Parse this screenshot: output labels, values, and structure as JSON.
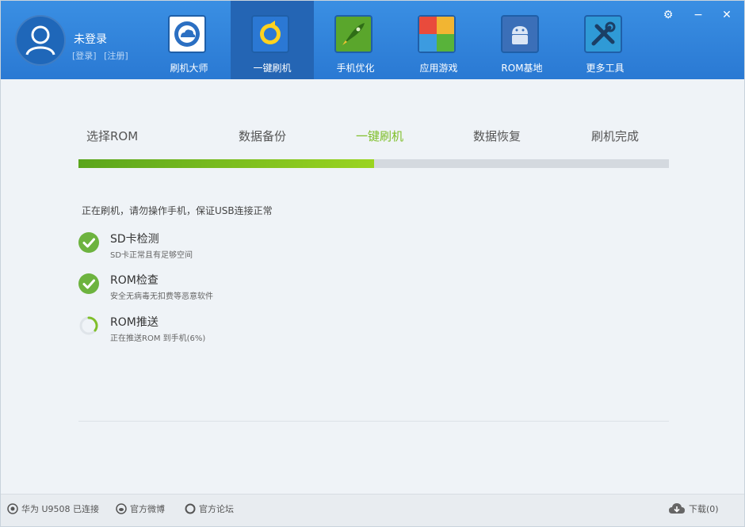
{
  "user": {
    "name": "未登录",
    "login": "[登录]",
    "register": "[注册]"
  },
  "nav": [
    {
      "label": "刷机大师",
      "icon": "cloud-icon",
      "active": false
    },
    {
      "label": "一键刷机",
      "icon": "refresh-icon",
      "active": true
    },
    {
      "label": "手机优化",
      "icon": "rocket-icon",
      "active": false
    },
    {
      "label": "应用游戏",
      "icon": "tiles-icon",
      "active": false
    },
    {
      "label": "ROM基地",
      "icon": "android-icon",
      "active": false
    },
    {
      "label": "更多工具",
      "icon": "tools-icon",
      "active": false
    }
  ],
  "window_controls": {
    "settings": "⚙",
    "minimize": "−",
    "close": "✕"
  },
  "steps": [
    "选择ROM",
    "数据备份",
    "一键刷机",
    "数据恢复",
    "刷机完成"
  ],
  "active_step": "一键刷机",
  "progress_fraction": 0.5,
  "status_message": "正在刷机，请勿操作手机，保证USB连接正常",
  "checks": [
    {
      "title": "SD卡检测",
      "subtitle": "SD卡正常且有足够空间",
      "state": "done"
    },
    {
      "title": "ROM检查",
      "subtitle": "安全无病毒无扣费等恶意软件",
      "state": "done"
    },
    {
      "title": "ROM推送",
      "subtitle": "正在推送ROM 到手机(6%)",
      "state": "in-progress"
    }
  ],
  "footer": {
    "device": "华为 U9508 已连接",
    "weibo": "官方微博",
    "forum": "官方论坛",
    "download": "下载(0)"
  },
  "colors": {
    "header_blue": "#2a79d3",
    "active_green": "#7fbf2a",
    "check_green": "#6db33f"
  }
}
